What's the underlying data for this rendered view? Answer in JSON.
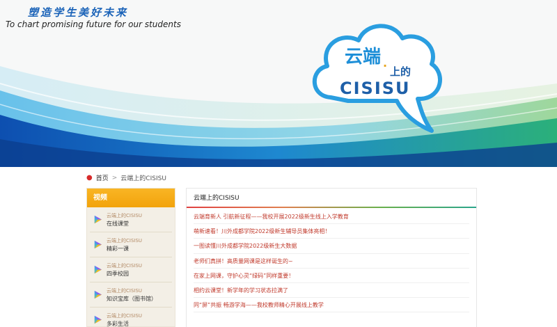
{
  "banner": {
    "slogan_cn": "塑造学生美好未来",
    "slogan_en": "To chart promising future for our students",
    "logo_line1": "云端",
    "logo_dot": "·",
    "logo_line2": "上的",
    "logo_line3": "CISISU"
  },
  "breadcrumb": {
    "home": "首页",
    "separator": ">",
    "current": "云端上的CISISU"
  },
  "sidebar": {
    "header": "视频",
    "items": [
      {
        "sub": "云端上的CISISU",
        "label": "在线课堂"
      },
      {
        "sub": "云端上的CISISU",
        "label": "精彩一课"
      },
      {
        "sub": "云端上的CISISU",
        "label": "四季校园"
      },
      {
        "sub": "云端上的CISISU",
        "label": "知识宝库（图书馆）"
      },
      {
        "sub": "云端上的CISISU",
        "label": "多彩生活"
      }
    ]
  },
  "main": {
    "title": "云端上的CISISU",
    "news": [
      "云端育新人 引航新征程——我校开展2022级新生线上入学教育",
      "萌新速看！川外成都学院2022级新生辅导员集体亮相！",
      "一图读懂川外成都学院2022级新生大数据",
      "老师们真拼！高质量网课是这样诞生的~",
      "在家上网课，守护心灵“绿码”同样重要！",
      "相约云课堂！新学年的学习状态拉满了",
      "同“屏”共振 畅游学海——我校教师精心开展线上教学"
    ]
  },
  "colors": {
    "accent_orange": "#f2a30c",
    "news_red": "#c0392b",
    "brand_blue": "#1b63b8",
    "sidebar_bg": "#f3efe6"
  }
}
